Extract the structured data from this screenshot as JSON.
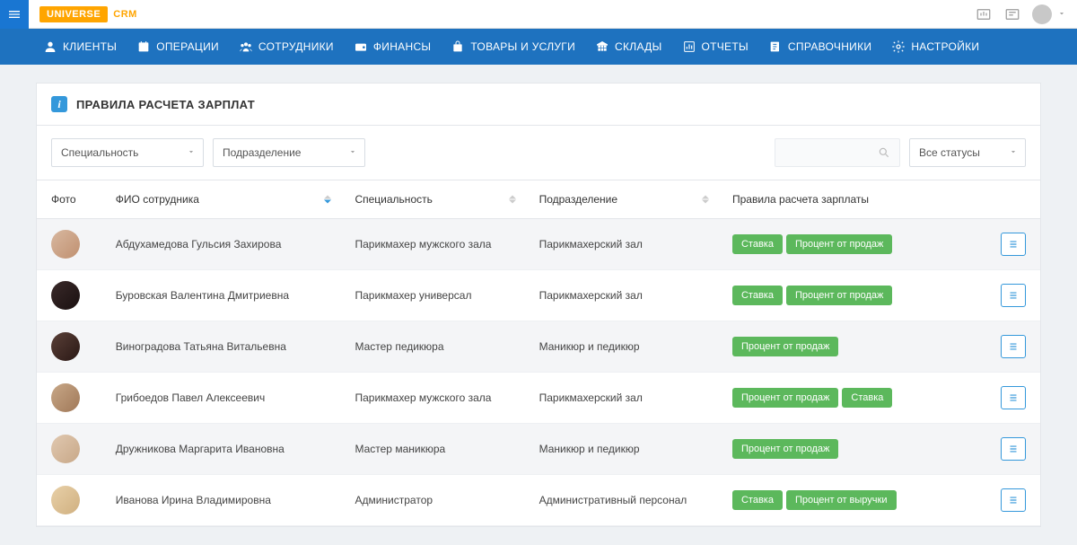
{
  "brand": {
    "logo": "UNIVERSE",
    "sub": "CRM"
  },
  "nav": [
    {
      "label": "КЛИЕНТЫ"
    },
    {
      "label": "ОПЕРАЦИИ"
    },
    {
      "label": "СОТРУДНИКИ"
    },
    {
      "label": "ФИНАНСЫ"
    },
    {
      "label": "ТОВАРЫ И УСЛУГИ"
    },
    {
      "label": "СКЛАДЫ"
    },
    {
      "label": "ОТЧЕТЫ"
    },
    {
      "label": "СПРАВОЧНИКИ"
    },
    {
      "label": "НАСТРОЙКИ"
    }
  ],
  "page_title": "ПРАВИЛА РАСЧЕТА ЗАРПЛАТ",
  "filters": {
    "specialty": "Специальность",
    "department": "Подразделение",
    "status": "Все статусы"
  },
  "columns": {
    "photo": "Фото",
    "name": "ФИО сотрудника",
    "specialty": "Специальность",
    "department": "Подразделение",
    "rules": "Правила расчета зарплаты"
  },
  "rows": [
    {
      "name": "Абдухамедова Гульсия Захирова",
      "specialty": "Парикмахер мужского зала",
      "department": "Парикмахерский зал",
      "rules": [
        "Ставка",
        "Процент от продаж"
      ]
    },
    {
      "name": "Буровская Валентина Дмитриевна",
      "specialty": "Парикмахер универсал",
      "department": "Парикмахерский зал",
      "rules": [
        "Ставка",
        "Процент от продаж"
      ]
    },
    {
      "name": "Виноградова Татьяна Витальевна",
      "specialty": "Мастер педикюра",
      "department": "Маникюр и педикюр",
      "rules": [
        "Процент от продаж"
      ]
    },
    {
      "name": "Грибоедов Павел Алексеевич",
      "specialty": "Парикмахер мужского зала",
      "department": "Парикмахерский зал",
      "rules": [
        "Процент от продаж",
        "Ставка"
      ]
    },
    {
      "name": "Дружникова Маргарита Ивановна",
      "specialty": "Мастер маникюра",
      "department": "Маникюр и педикюр",
      "rules": [
        "Процент от продаж"
      ]
    },
    {
      "name": "Иванова Ирина Владимировна",
      "specialty": "Администратор",
      "department": "Административный персонал",
      "rules": [
        "Ставка",
        "Процент от выручки"
      ]
    }
  ]
}
